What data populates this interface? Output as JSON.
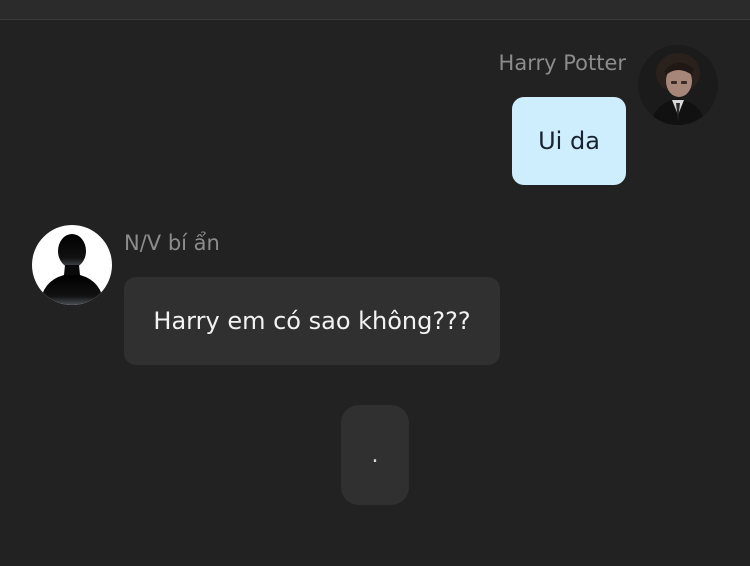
{
  "chat": {
    "messages": [
      {
        "sender": "Harry Potter",
        "text": "Ui da",
        "side": "outgoing",
        "avatar_icon": "harry-potter-portrait"
      },
      {
        "sender": "N/V bí ẩn",
        "text": "Harry em có sao không???",
        "side": "incoming",
        "avatar_icon": "silhouette-person-icon"
      }
    ],
    "typing_indicator": "."
  },
  "colors": {
    "background": "#222222",
    "outgoing_bubble": "#cfeefd",
    "incoming_bubble": "#303030",
    "sender_name": "#8c8c8c"
  }
}
